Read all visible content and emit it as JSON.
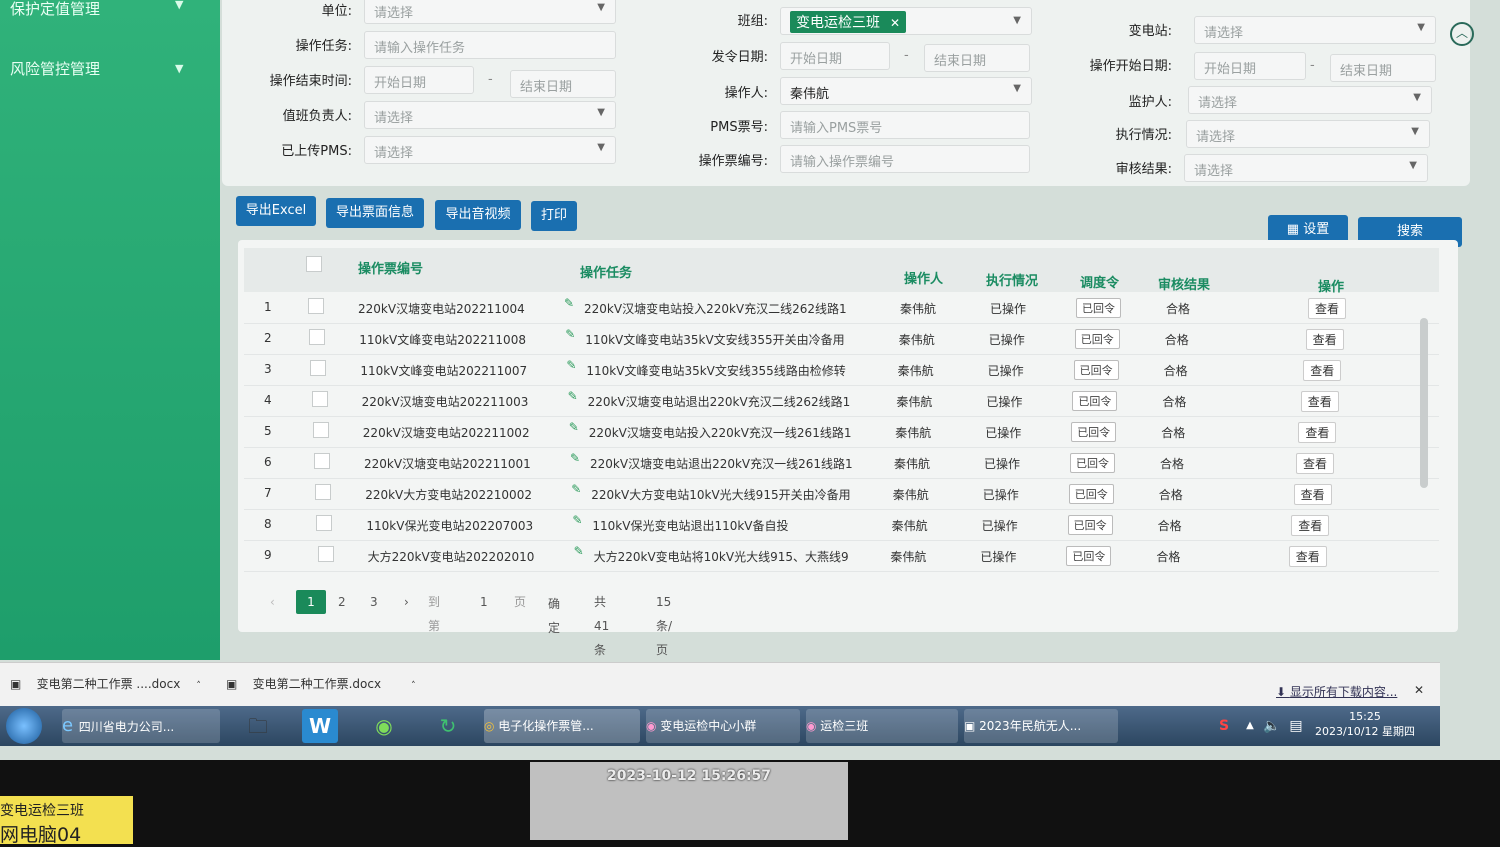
{
  "sidebar": {
    "items": [
      {
        "label": "保护定值管理"
      },
      {
        "label": "风险管控管理"
      }
    ]
  },
  "filters": {
    "unit": {
      "label": "单位:",
      "placeholder": "请选择"
    },
    "task": {
      "label": "操作任务:",
      "placeholder": "请输入操作任务"
    },
    "end_time": {
      "label": "操作结束时间:",
      "start": "开始日期",
      "end": "结束日期"
    },
    "duty_lead": {
      "label": "值班负责人:",
      "placeholder": "请选择"
    },
    "pms_uploaded": {
      "label": "已上传PMS:",
      "placeholder": "请选择"
    },
    "team": {
      "label": "班组:",
      "value": "变电运检三班"
    },
    "issue_date": {
      "label": "发令日期:",
      "start": "开始日期",
      "end": "结束日期"
    },
    "operator": {
      "label": "操作人:",
      "value": "秦伟航"
    },
    "pms_no": {
      "label": "PMS票号:",
      "placeholder": "请输入PMS票号"
    },
    "ticket_no": {
      "label": "操作票编号:",
      "placeholder": "请输入操作票编号"
    },
    "station": {
      "label": "变电站:",
      "placeholder": "请选择"
    },
    "start_date": {
      "label": "操作开始日期:",
      "start": "开始日期",
      "end": "结束日期"
    },
    "guardian": {
      "label": "监护人:",
      "placeholder": "请选择"
    },
    "exec_status": {
      "label": "执行情况:",
      "placeholder": "请选择"
    },
    "audit_result": {
      "label": "审核结果:",
      "placeholder": "请选择"
    }
  },
  "toolbar": {
    "export_excel": "导出Excel",
    "export_ticket": "导出票面信息",
    "export_av": "导出音视频",
    "print": "打印",
    "settings": "设置",
    "search": "搜索"
  },
  "table": {
    "columns": [
      "操作票编号",
      "操作任务",
      "操作人",
      "执行情况",
      "调度令",
      "审核结果",
      "操作"
    ],
    "rows": [
      {
        "idx": "1",
        "no": "220kV汉塘变电站202211004",
        "task": "220kV汉塘变电站投入220kV充汉二线262线路1",
        "op": "秦伟航",
        "exec": "已操作",
        "order": "已回令",
        "audit": "合格",
        "action": "查看"
      },
      {
        "idx": "2",
        "no": "110kV文峰变电站202211008",
        "task": "110kV文峰变电站35kV文安线355开关由冷备用",
        "op": "秦伟航",
        "exec": "已操作",
        "order": "已回令",
        "audit": "合格",
        "action": "查看"
      },
      {
        "idx": "3",
        "no": "110kV文峰变电站202211007",
        "task": "110kV文峰变电站35kV文安线355线路由检修转",
        "op": "秦伟航",
        "exec": "已操作",
        "order": "已回令",
        "audit": "合格",
        "action": "查看"
      },
      {
        "idx": "4",
        "no": "220kV汉塘变电站202211003",
        "task": "220kV汉塘变电站退出220kV充汉二线262线路1",
        "op": "秦伟航",
        "exec": "已操作",
        "order": "已回令",
        "audit": "合格",
        "action": "查看"
      },
      {
        "idx": "5",
        "no": "220kV汉塘变电站202211002",
        "task": "220kV汉塘变电站投入220kV充汉一线261线路1",
        "op": "秦伟航",
        "exec": "已操作",
        "order": "已回令",
        "audit": "合格",
        "action": "查看"
      },
      {
        "idx": "6",
        "no": "220kV汉塘变电站202211001",
        "task": "220kV汉塘变电站退出220kV充汉一线261线路1",
        "op": "秦伟航",
        "exec": "已操作",
        "order": "已回令",
        "audit": "合格",
        "action": "查看"
      },
      {
        "idx": "7",
        "no": "220kV大方变电站202210002",
        "task": "220kV大方变电站10kV光大线915开关由冷备用",
        "op": "秦伟航",
        "exec": "已操作",
        "order": "已回令",
        "audit": "合格",
        "action": "查看"
      },
      {
        "idx": "8",
        "no": "110kV保光变电站202207003",
        "task": "110kV保光变电站退出110kV备自投",
        "op": "秦伟航",
        "exec": "已操作",
        "order": "已回令",
        "audit": "合格",
        "action": "查看"
      },
      {
        "idx": "9",
        "no": "大方220kV变电站202202010",
        "task": "大方220kV变电站将10kV光大线915、大燕线9",
        "op": "秦伟航",
        "exec": "已操作",
        "order": "已回令",
        "audit": "合格",
        "action": "查看"
      }
    ]
  },
  "pagination": {
    "pages": [
      "1",
      "2",
      "3"
    ],
    "goto": "到第",
    "goto_value": "1",
    "page_unit": "页",
    "confirm": "确定",
    "total": "共 41 条",
    "page_size": "15 条/页"
  },
  "downloads": {
    "items": [
      "变电第二种工作票 ....docx",
      "变电第二种工作票.docx"
    ],
    "show_all": "显示所有下载内容..."
  },
  "taskbar": {
    "apps": [
      "四川省电力公司...",
      "电子化操作票管...",
      "变电运检中心小群",
      "运检三班",
      "2023年民航无人..."
    ],
    "time": "15:25",
    "date": "2023/10/12 星期四",
    "ime": "S"
  },
  "overlay": {
    "timestamp": "2023-10-12 15:26:57",
    "sticker_line1": "变电运检三班",
    "sticker_line2": "网电脑04"
  },
  "colors": {
    "accent": "#1a8a5a",
    "button": "#1a6fb0",
    "sidebar": "#27a872"
  }
}
